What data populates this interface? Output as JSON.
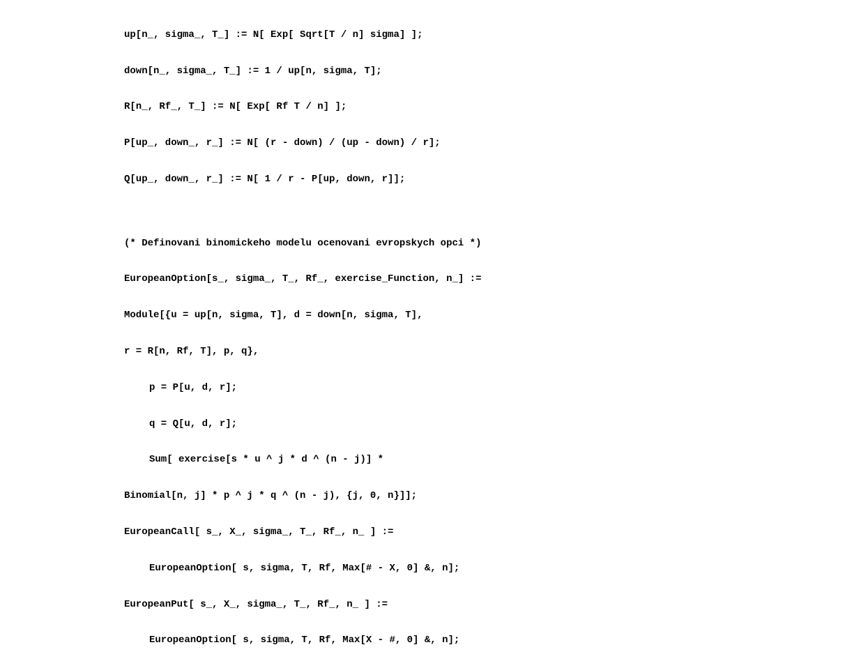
{
  "code": {
    "l1": "up[n_, sigma_, T_] := N[ Exp[ Sqrt[T / n] sigma] ];",
    "l2": "down[n_, sigma_, T_] := 1 / up[n, sigma, T];",
    "l3": "R[n_, Rf_, T_] := N[ Exp[ Rf T / n] ];",
    "l4": "P[up_, down_, r_] := N[ (r - down) / (up - down) / r];",
    "l5": "Q[up_, down_, r_] := N[ 1 / r - P[up, down, r]];",
    "l6": "(* Definovani binomickeho modelu ocenovani evropskych opci *)",
    "l7": "EuropeanOption[s_, sigma_, T_, Rf_, exercise_Function, n_] :=",
    "l8": "Module[{u = up[n, sigma, T], d = down[n, sigma, T],",
    "l9": "r = R[n, Rf, T], p, q},",
    "l10": "p = P[u, d, r];",
    "l11": "q = Q[u, d, r];",
    "l12": "Sum[ exercise[s * u ^ j * d ^ (n - j)] *",
    "l13": "Binomial[n, j] * p ^ j * q ^ (n - j), {j, 0, n}]];",
    "l14": "EuropeanCall[ s_, X_, sigma_, T_, Rf_, n_ ] :=",
    "l15": "EuropeanOption[ s, sigma, T, Rf, Max[# - X, 0] &, n];",
    "l16": "EuropeanPut[ s_, X_, sigma_, T_, Rf_, n_ ] :=",
    "l17": "EuropeanOption[ s, sigma, T, Rf, Max[X - #, 0] &, n];"
  }
}
